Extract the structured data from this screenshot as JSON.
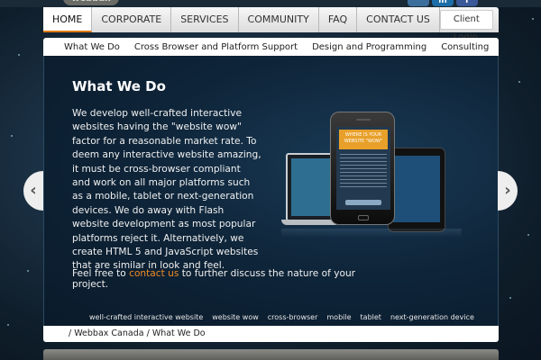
{
  "header": {
    "logo": "webbax",
    "social": [
      {
        "icon": "share-icon",
        "label": ""
      },
      {
        "icon": "linkedin-icon",
        "label": "in"
      },
      {
        "icon": "facebook-icon",
        "label": "f"
      }
    ]
  },
  "main_nav": {
    "items": [
      "HOME",
      "CORPORATE",
      "SERVICES",
      "COMMUNITY",
      "FAQ",
      "CONTACT US"
    ],
    "active": "HOME",
    "client_login": "Client Login"
  },
  "sub_nav": {
    "items": [
      "What We Do",
      "Cross Browser and Platform Support",
      "Design and Programming",
      "Consulting"
    ]
  },
  "content": {
    "title": "What We Do",
    "body": "We develop well-crafted interactive websites having the \"website wow\" factor for a reasonable market rate. To deem any interactive website amazing, it must be cross-browser compliant and work on all major platforms such as a mobile, tablet or next-generation devices. We do away with Flash website development as most popular platforms reject it. Alternatively, we create HTML 5 and JavaScript websites that are similar in look and feel.",
    "cta_before": "Feel free to ",
    "cta_link": "contact us",
    "cta_after": " to further discuss the nature of your project.",
    "tags": [
      "well-crafted interactive website",
      "website wow",
      "cross-browser",
      "mobile",
      "tablet",
      "next-generation device"
    ],
    "phone_banner": "WHERE IS YOUR WEBSITE \"WOW\""
  },
  "breadcrumb": "/ Webbax Canada / What We Do",
  "colors": {
    "accent": "#e07a16",
    "link": "#f08a24",
    "panel_bg": "#0e2438"
  }
}
